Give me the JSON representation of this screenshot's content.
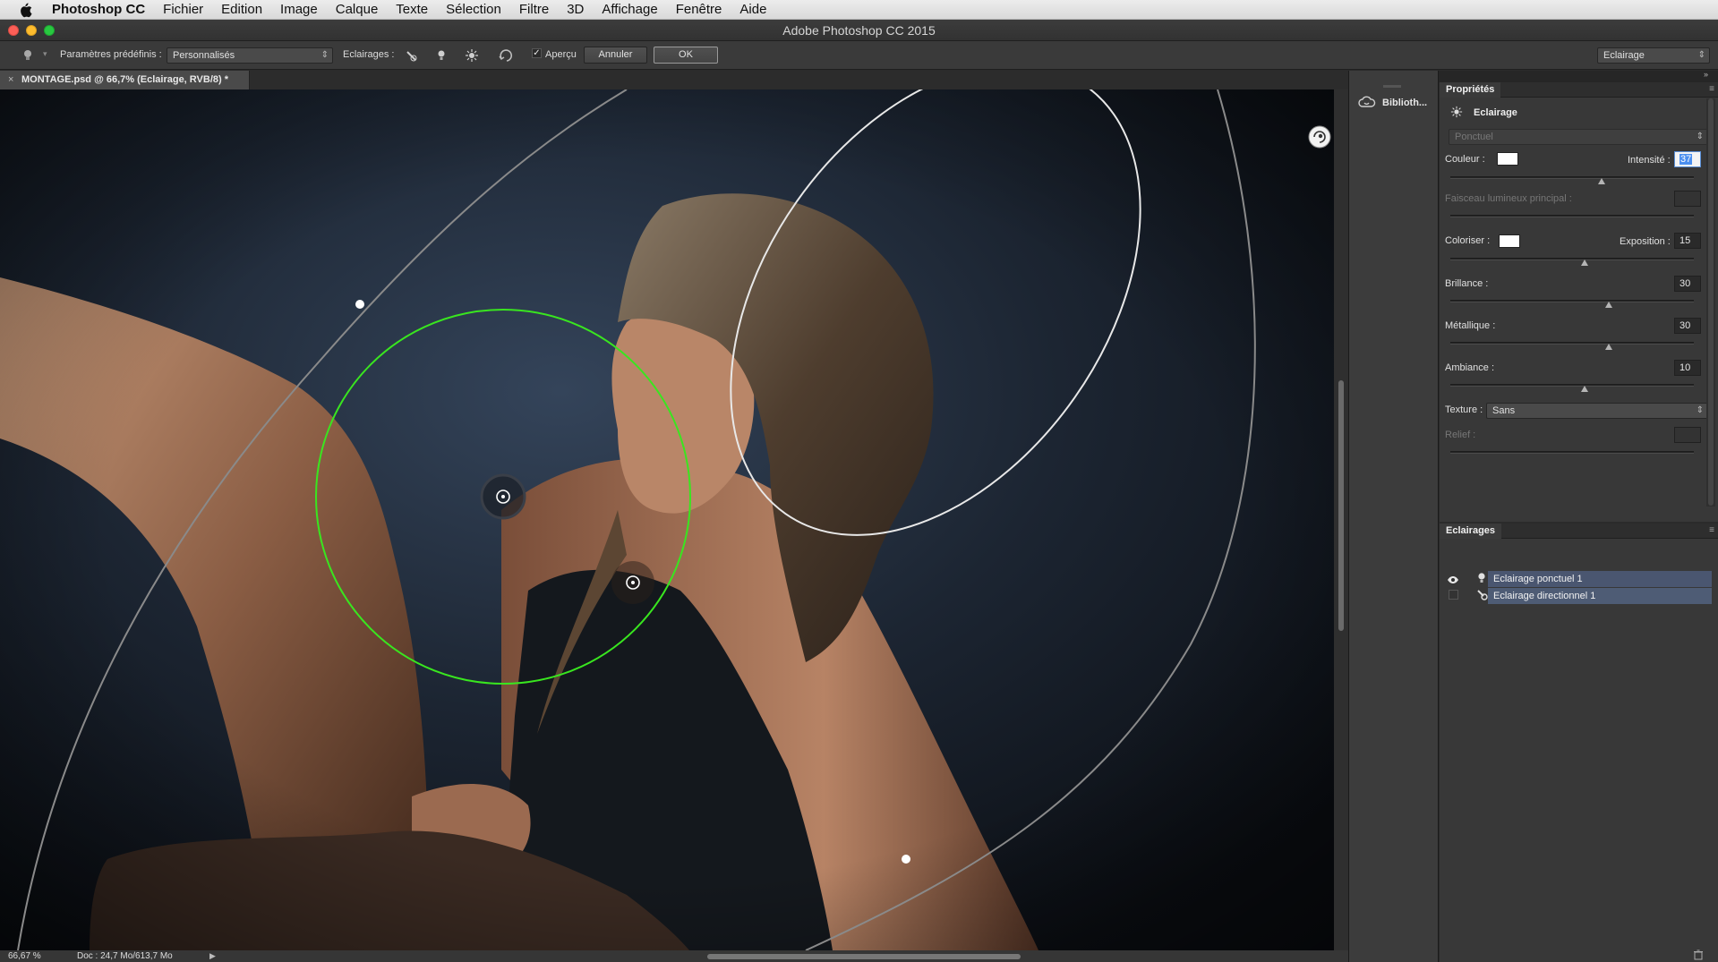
{
  "menubar": {
    "app": "Photoshop CC",
    "items": [
      "Fichier",
      "Edition",
      "Image",
      "Calque",
      "Texte",
      "Sélection",
      "Filtre",
      "3D",
      "Affichage",
      "Fenêtre",
      "Aide"
    ]
  },
  "window": {
    "title": "Adobe Photoshop CC 2015"
  },
  "options": {
    "presets_label": "Paramètres prédéfinis :",
    "presets_value": "Personnalisés",
    "lights_label": "Eclairages :",
    "preview_label": "Aperçu",
    "preview_checked": true,
    "cancel_label": "Annuler",
    "ok_label": "OK",
    "workspace_value": "Eclairage"
  },
  "document": {
    "tab_title": "MONTAGE.psd @ 66,7% (Eclairage, RVB/8) *",
    "tab_close": "×"
  },
  "status": {
    "zoom": "66,67 %",
    "doc_info": "Doc : 24,7 Mo/613,7 Mo"
  },
  "dock": {
    "libraries_label": "Biblioth..."
  },
  "properties": {
    "tab": "Propriétés",
    "section_title": "Eclairage",
    "light_type": "Ponctuel",
    "color_label": "Couleur :",
    "color_value": "#ffffff",
    "intensity_label": "Intensité :",
    "intensity": "37",
    "hotspot_label": "Faisceau lumineux principal :",
    "colorize_label": "Coloriser :",
    "colorize_value": "#ffffff",
    "exposure_label": "Exposition :",
    "exposure": "15",
    "gloss_label": "Brillance :",
    "gloss": "30",
    "metallic_label": "Métallique :",
    "metallic": "30",
    "ambience_label": "Ambiance :",
    "ambience": "10",
    "texture_label": "Texture :",
    "texture_value": "Sans",
    "height_label": "Relief :",
    "sliders": {
      "intensity": 0.62,
      "exposure": 0.55,
      "gloss": 0.65,
      "metallic": 0.65,
      "ambience": 0.55
    }
  },
  "lights_panel": {
    "tab": "Eclairages",
    "items": [
      {
        "label": "Eclairage ponctuel 1",
        "visible": true,
        "icon": "bulb-icon"
      },
      {
        "label": "Eclairage directionnel 1",
        "visible": false,
        "icon": "directional-light-icon"
      }
    ]
  },
  "colors": {
    "menubar_bg": "#e3e3e3",
    "panel_bg": "#383838",
    "spot_ring": "#39e61f",
    "selected_row": "#4e5c75"
  }
}
